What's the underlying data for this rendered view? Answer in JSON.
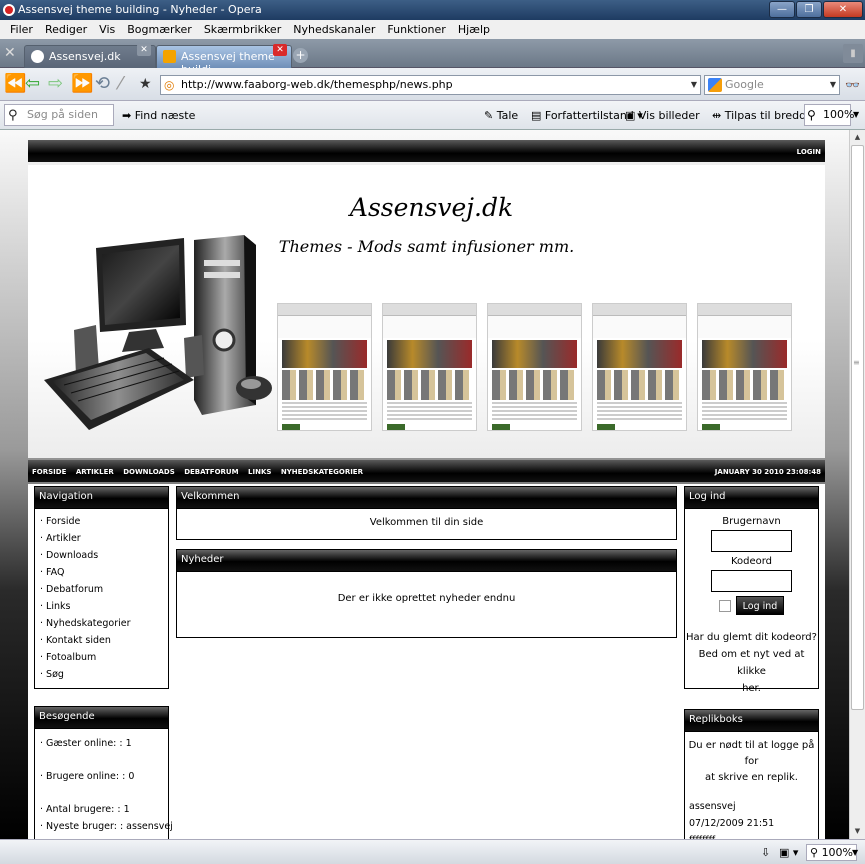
{
  "window": {
    "title": "Assensvej theme building - Nyheder - Opera"
  },
  "menu": [
    "Filer",
    "Rediger",
    "Vis",
    "Bogmærker",
    "Skærmbrikker",
    "Nyhedskanaler",
    "Funktioner",
    "Hjælp"
  ],
  "tabs": [
    {
      "label": "Assensvej.dk"
    },
    {
      "label": "Assensvej theme buildi..."
    }
  ],
  "address": {
    "url": "http://www.faaborg-web.dk/themesphp/news.php",
    "search_engine": "Google"
  },
  "findbar": {
    "placeholder": "Søg på siden",
    "find_next": "Find næste",
    "speak": "Tale",
    "author_mode": "Forfattertilstand",
    "show_images": "Vis billeder",
    "fit_width": "Tilpas til bredden",
    "zoom": "100%"
  },
  "status": {
    "zoom": "100%"
  },
  "site": {
    "login_link": "LOGIN",
    "title": "Assensvej.dk",
    "slogan": "Themes - Mods samt infusioner mm.",
    "nav": [
      "FORSIDE",
      "ARTIKLER",
      "DOWNLOADS",
      "DEBATFORUM",
      "LINKS",
      "NYHEDSKATEGORIER"
    ],
    "date": "JANUARY 30 2010 23:08:48",
    "navigation": {
      "title": "Navigation",
      "items": [
        "Forside",
        "Artikler",
        "Downloads",
        "FAQ",
        "Debatforum",
        "Links",
        "Nyhedskategorier",
        "Kontakt siden",
        "Fotoalbum",
        "Søg"
      ]
    },
    "visitors": {
      "title": "Besøgende",
      "guests": "Gæster online: : 1",
      "members": "Brugere online: : 0",
      "count": "Antal brugere: : 1",
      "newest": "Nyeste bruger: : assensvej"
    },
    "welcome": {
      "title": "Velkommen",
      "text": "Velkommen til din side"
    },
    "news": {
      "title": "Nyheder",
      "text": "Der er ikke oprettet nyheder endnu"
    },
    "login": {
      "title": "Log ind",
      "username_label": "Brugernavn",
      "password_label": "Kodeord",
      "button": "Log ind",
      "forgot_line1": "Har du glemt dit kodeord?",
      "forgot_line2": "Bed om et nyt ved at klikke",
      "forgot_line3": "her."
    },
    "shoutbox": {
      "title": "Replikboks",
      "notice_line1": "Du er nødt til at logge på for",
      "notice_line2": "at skrive en replik.",
      "user": "assensvej",
      "datetime": "07/12/2009 21:51",
      "message": "ffffffff"
    }
  }
}
